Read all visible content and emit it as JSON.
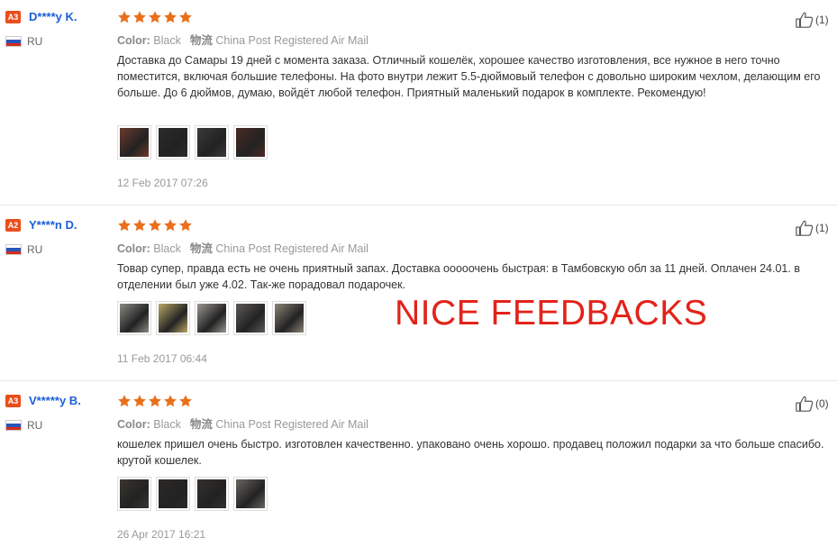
{
  "banner": "NICE FEEDBACKS",
  "labels": {
    "color": "Color:",
    "shipping_prefix": "物流"
  },
  "star_color": "#e96f1b",
  "reviews": [
    {
      "level": "A3",
      "user": "D****y K.",
      "country": "RU",
      "rating": 5,
      "color": "Black",
      "shipping": "China Post Registered Air Mail",
      "text": "Доставка до Самары 19 дней с момента заказа. Отличный кошелёк, хорошее качество изготовления, все нужное в него точно поместится, включая большие телефоны. На фото внутри лежит 5.5-дюймовый телефон с довольно широким чехлом, делающим его больше. До 6 дюймов, думаю, войдёт любой телефон. Приятный маленький подарок в комплекте. Рекомендую!",
      "photos": [
        "#6b3a2e",
        "#2b2b2b",
        "#3a3a3a",
        "#4a2a24"
      ],
      "date": "12 Feb 2017 07:26",
      "likes": "(1)"
    },
    {
      "level": "A2",
      "user": "Y****n D.",
      "country": "RU",
      "rating": 5,
      "color": "Black",
      "shipping": "China Post Registered Air Mail",
      "text": "Товар супер, правда есть не очень приятный запах. Доставка ооооочень быстрая: в Тамбовскую обл за 11 дней. Оплачен 24.01. в отделении был уже 4.02. Так-же порадовал подарочек.",
      "photos": [
        "#8a8a84",
        "#b8a866",
        "#9a9690",
        "#5c5a58",
        "#8c8478"
      ],
      "date": "11 Feb 2017 06:44",
      "likes": "(1)"
    },
    {
      "level": "A3",
      "user": "V*****y B.",
      "country": "RU",
      "rating": 5,
      "color": "Black",
      "shipping": "China Post Registered Air Mail",
      "text": "кошелек пришел очень быстро. изготовлен качественно. упаковано очень хорошо. продавец положил подарки за что больше спасибо. крутой кошелек.",
      "photos": [
        "#3a3630",
        "#2c2a28",
        "#34302c",
        "#6a6660"
      ],
      "date": "26 Apr 2017 16:21",
      "likes": "(0)"
    }
  ]
}
